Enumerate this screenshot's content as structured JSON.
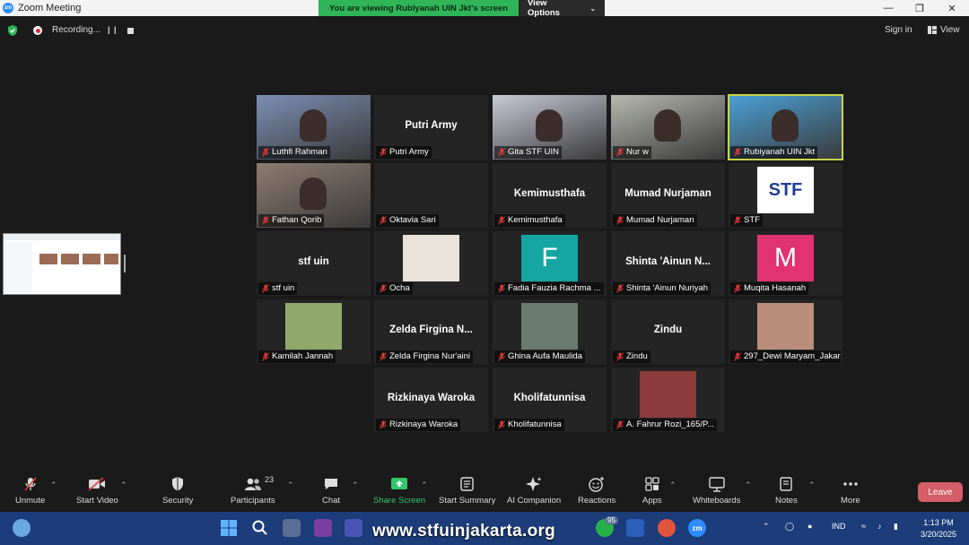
{
  "window": {
    "title": "Zoom Meeting",
    "logo": "zm"
  },
  "share_banner": {
    "message": "You are viewing Rubiyanah UIN Jkt's screen",
    "view_options": "View Options"
  },
  "status": {
    "recording": "Recording...",
    "sign_in": "Sign in",
    "view": "View"
  },
  "participants": [
    {
      "name": "Luthfi Rahman",
      "display": "",
      "type": "video",
      "bg": "#7b8fb4"
    },
    {
      "name": "Putri Army",
      "display": "Putri Army",
      "type": "name"
    },
    {
      "name": "Gita STF UIN",
      "display": "",
      "type": "video",
      "bg": "#c7c9d6"
    },
    {
      "name": "Nur w",
      "display": "",
      "type": "video",
      "bg": "#b6b8b0"
    },
    {
      "name": "Rubiyanah UIN Jkt",
      "display": "",
      "type": "video",
      "bg": "#4aa0d6",
      "active": true
    },
    {
      "name": "Fathan Qorib",
      "display": "",
      "type": "video",
      "bg": "#8d7c70"
    },
    {
      "name": "Oktavia Sari",
      "display": "",
      "type": "blank"
    },
    {
      "name": "Kemimusthafa",
      "display": "Kemimusthafa",
      "type": "name"
    },
    {
      "name": "Mumad Nurjaman",
      "display": "Mumad Nurjaman",
      "type": "name"
    },
    {
      "name": "STF",
      "display": "STF",
      "type": "logo",
      "bg": "#ffffff"
    },
    {
      "name": "stf uin",
      "display": "stf uin",
      "type": "name"
    },
    {
      "name": "Ocha",
      "display": "",
      "type": "photo",
      "bg": "#e8e2da"
    },
    {
      "name": "Fadia Fauzia Rachma ...",
      "display": "F",
      "type": "avatar",
      "bg": "#15a6a4"
    },
    {
      "name": "Shinta 'Ainun Nuriyah",
      "display": "Shinta  'Ainun N...",
      "type": "name"
    },
    {
      "name": "Muqita Hasanah",
      "display": "M",
      "type": "avatar",
      "bg": "#e0336f"
    },
    {
      "name": "Kamilah Jannah",
      "display": "",
      "type": "photo",
      "bg": "#8faa6c"
    },
    {
      "name": "Zelda Firgina Nur'aini",
      "display": "Zelda  Firgina  N...",
      "type": "name"
    },
    {
      "name": "Ghina Aufa Maulida",
      "display": "",
      "type": "photo",
      "bg": "#6b7a6e"
    },
    {
      "name": "Zindu",
      "display": "Zindu",
      "type": "name"
    },
    {
      "name": "297_Dewi Maryam_Jakar...",
      "display": "",
      "type": "photo",
      "bg": "#b98f7c"
    },
    {
      "name": "Rizkinaya Waroka",
      "display": "Rizkinaya Waroka",
      "type": "name"
    },
    {
      "name": "Kholifatunnisa",
      "display": "Kholifatunnisa",
      "type": "name"
    },
    {
      "name": "A. Fahrur Rozi_165/P...",
      "display": "",
      "type": "photo",
      "bg": "#8c3a3a"
    }
  ],
  "toolbar": {
    "unmute": "Unmute",
    "start_video": "Start Video",
    "security": "Security",
    "participants": "Participants",
    "participants_count": "23",
    "chat": "Chat",
    "share_screen": "Share Screen",
    "start_summary": "Start Summary",
    "ai_companion": "AI Companion",
    "reactions": "Reactions",
    "apps": "Apps",
    "whiteboards": "Whiteboards",
    "notes": "Notes",
    "more": "More",
    "leave": "Leave"
  },
  "taskbar": {
    "watermark": "www.stfuinjakarta.org",
    "language": "IND",
    "time": "1:13 PM",
    "date": "3/20/2025",
    "whatsapp_badge": "95",
    "zoom_label": "zm"
  },
  "colors": {
    "accent_green": "#2fb558",
    "leave": "#d45d68",
    "active_border": "#c9d34a"
  }
}
